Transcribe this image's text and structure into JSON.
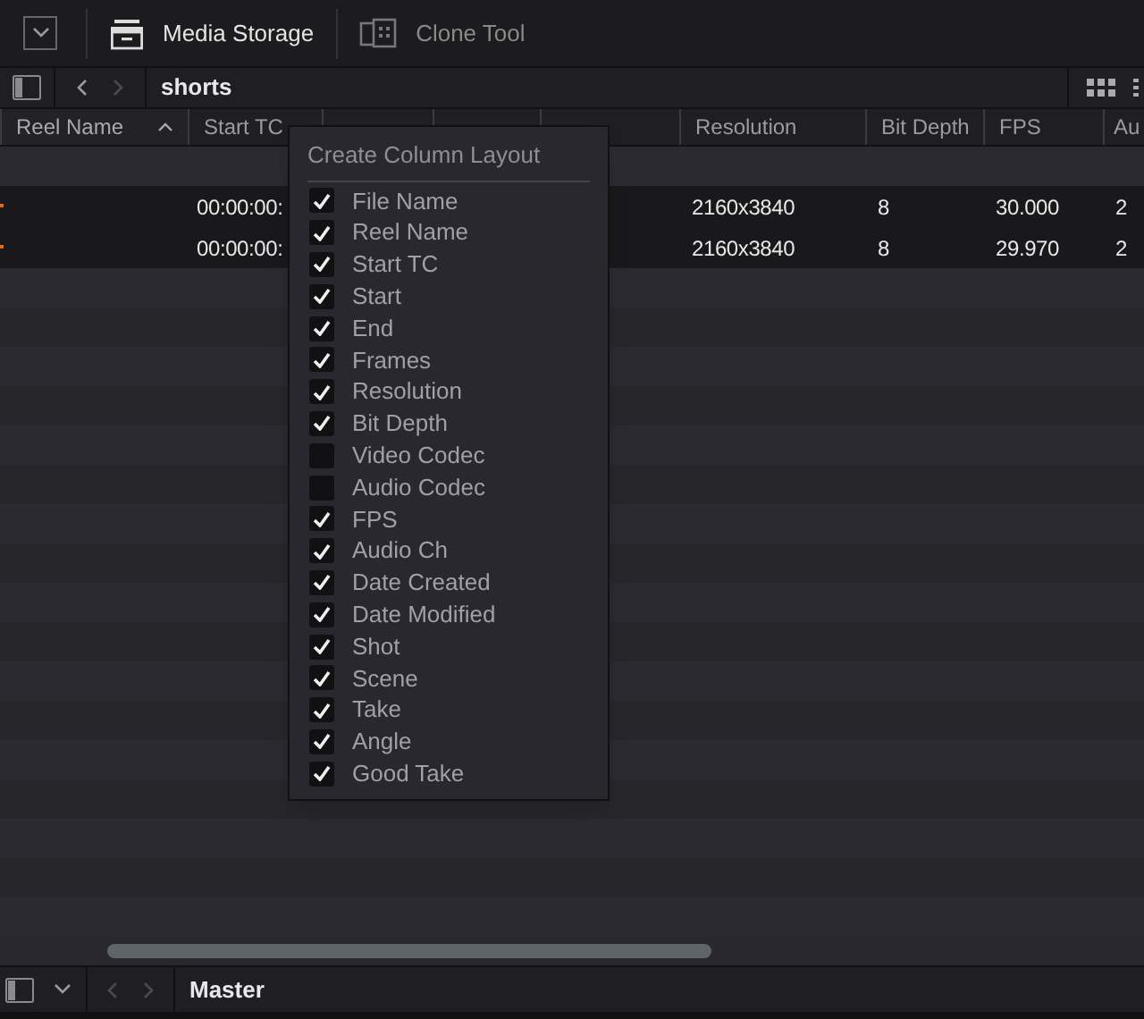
{
  "toolbar": {
    "items": [
      {
        "label": "Media Storage",
        "selected": true,
        "kind": "storage"
      },
      {
        "label": "Clone Tool",
        "selected": false,
        "kind": "clone"
      }
    ]
  },
  "path_bar": {
    "title": "shorts"
  },
  "table": {
    "columns": [
      {
        "label": "Reel Name",
        "sorted": true
      },
      {
        "label": "Start TC",
        "sorted": false
      },
      {},
      {},
      {},
      {
        "label": "Resolution",
        "sorted": false
      },
      {
        "label": "Bit Depth",
        "sorted": false
      },
      {
        "label": "FPS",
        "sorted": false
      },
      {
        "label": "Au",
        "sorted": false
      }
    ],
    "rows": [
      {
        "cells": [
          "",
          "00:00:00:",
          "",
          "",
          "",
          "2160x3840",
          "8",
          "30.000",
          "2"
        ]
      },
      {
        "cells": [
          "",
          "00:00:00:",
          "",
          "",
          "",
          "2160x3840",
          "8",
          "29.970",
          "2"
        ]
      }
    ]
  },
  "menu": {
    "title": "Create Column Layout",
    "items": [
      {
        "label": "File Name",
        "checked": true
      },
      {
        "label": "Reel Name",
        "checked": true
      },
      {
        "label": "Start TC",
        "checked": true
      },
      {
        "label": "Start",
        "checked": true
      },
      {
        "label": "End",
        "checked": true
      },
      {
        "label": "Frames",
        "checked": true
      },
      {
        "label": "Resolution",
        "checked": true
      },
      {
        "label": "Bit Depth",
        "checked": true
      },
      {
        "label": "Video Codec",
        "checked": false
      },
      {
        "label": "Audio Codec",
        "checked": false
      },
      {
        "label": "FPS",
        "checked": true
      },
      {
        "label": "Audio Ch",
        "checked": true
      },
      {
        "label": "Date Created",
        "checked": true
      },
      {
        "label": "Date Modified",
        "checked": true
      },
      {
        "label": "Shot",
        "checked": true
      },
      {
        "label": "Scene",
        "checked": true
      },
      {
        "label": "Take",
        "checked": true
      },
      {
        "label": "Angle",
        "checked": true
      },
      {
        "label": "Good Take",
        "checked": true
      }
    ]
  },
  "bottom_bar": {
    "title": "Master"
  }
}
